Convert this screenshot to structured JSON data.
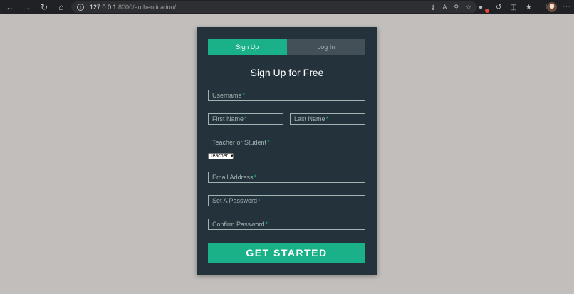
{
  "browser": {
    "url_host": "127.0.0.1",
    "url_path": ":8000/authentication/"
  },
  "colors": {
    "accent": "#1ab188",
    "card_bg": "#24323c",
    "page_bg": "#c1bebb"
  },
  "tabs": [
    {
      "label": "Sign Up",
      "active": true
    },
    {
      "label": "Log In",
      "active": false
    }
  ],
  "form": {
    "heading": "Sign Up for Free",
    "username_placeholder": "Username",
    "first_name_placeholder": "First Name",
    "last_name_placeholder": "Last Name",
    "role_label": "Teacher or Student",
    "role_selected": "Teacher",
    "email_placeholder": "Email Address",
    "password_placeholder": "Set A Password",
    "confirm_password_placeholder": "Confirm Password",
    "required_marker": "*",
    "submit_label": "GET STARTED"
  }
}
